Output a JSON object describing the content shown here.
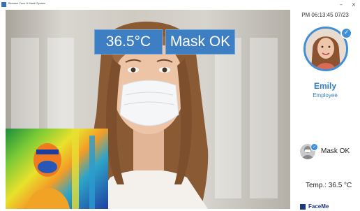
{
  "window": {
    "title": "Biosane Face & Mask System",
    "minimize_glyph": "–",
    "close_glyph": "×"
  },
  "camera": {
    "temperature": "36.5°C",
    "mask_status": "Mask OK"
  },
  "panel": {
    "clock": "PM 06:13:45 07/23",
    "person_name": "Emily",
    "person_role": "Employee",
    "check_glyph": "✓",
    "mask_status": "Mask OK",
    "temperature_label": "Temp.: 36.5 °C",
    "brand": "FaceMe"
  },
  "colors": {
    "accent": "#3f8fd6",
    "overlay_bg": "#3e7fc3",
    "brand": "#1e3a78"
  }
}
